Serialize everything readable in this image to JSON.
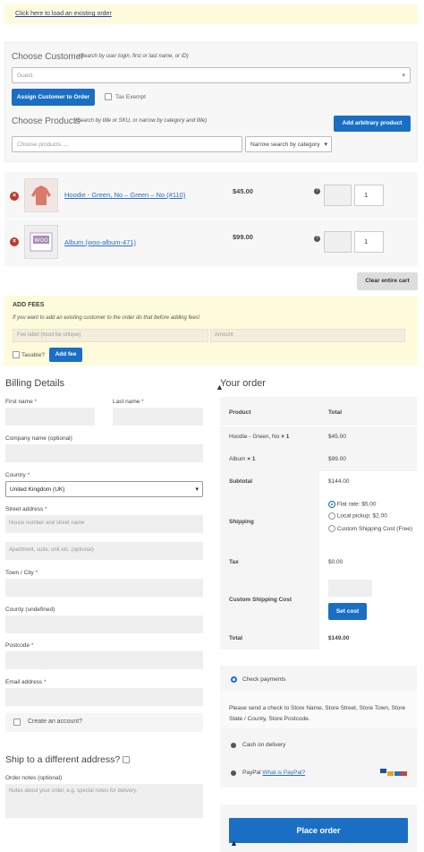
{
  "notice": {
    "link": "Click here to load an existing order"
  },
  "customer": {
    "title": "Choose Customer",
    "hint": "(Search by user login, first or last name, or ID)",
    "select_value": "Guest",
    "assign_btn": "Assign Customer to Order",
    "tax_exempt": "Tax Exempt"
  },
  "products": {
    "title": "Choose Products",
    "hint": "(Search by title or SKU, or narrow by category and title)",
    "add_btn": "Add arbitrary product",
    "search_placeholder": "Choose products ....",
    "narrow": "Narrow search by category"
  },
  "cart": [
    {
      "name": "Hoodie - Green, No – Green – No (#110)",
      "price": "$45.00",
      "qty": "1"
    },
    {
      "name": "Album (woo-album-471)",
      "price": "$99.00",
      "qty": "1"
    }
  ],
  "clear_cart": "Clear entire cart",
  "fees": {
    "title": "ADD FEES",
    "hint": "If you want to add an existing customer to the order do that before adding fees!",
    "label_ph": "Fee label (must be unique)",
    "amount_ph": "Amount",
    "taxable": "Taxable?",
    "add_btn": "Add fee"
  },
  "billing": {
    "title": "Billing Details",
    "first_name": "First name",
    "last_name": "Last name",
    "company": "Company name (optional)",
    "country": "Country",
    "country_value": "United Kingdom (UK)",
    "street": "Street address",
    "street_ph1": "House number and street name",
    "street_ph2": "Apartment, suite, unit etc. (optional)",
    "town": "Town / City",
    "county": "County (undefined)",
    "postcode": "Postcode",
    "email": "Email address",
    "create_account": "Create an account?",
    "req": "*"
  },
  "shipping": {
    "title": "Ship to a different address?",
    "notes_label": "Order notes (optional)",
    "notes_ph": "Notes about your order, e.g. special notes for delivery."
  },
  "order": {
    "title": "Your order",
    "col_product": "Product",
    "col_total": "Total",
    "items": [
      {
        "name": "Hoodie - Green, No",
        "qty": "× 1",
        "total": "$45.00"
      },
      {
        "name": "Album",
        "qty": "× 1",
        "total": "$99.00"
      }
    ],
    "subtotal_label": "Subtotal",
    "subtotal": "$144.00",
    "shipping_label": "Shipping",
    "ship_opts": [
      "Flat rate: $5.00",
      "Local pickup: $2.00",
      "Custom Shipping Cost (Free)"
    ],
    "tax_label": "Tax",
    "tax": "$0.00",
    "custom_label": "Custom Shipping Cost",
    "set_cost": "Set cost",
    "total_label": "Total",
    "total": "$149.00"
  },
  "payment": {
    "check": "Check payments",
    "check_desc": "Please send a check to Store Name, Store Street, Store Town, Store State / County, Store Postcode.",
    "cod": "Cash on delivery",
    "paypal": "PayPal",
    "paypal_link": "What is PayPal?",
    "place_order": "Place order"
  },
  "colors": {
    "accent": "#1a6fc4",
    "notice_bg": "#fdfbdc",
    "remove": "#c0392b"
  }
}
